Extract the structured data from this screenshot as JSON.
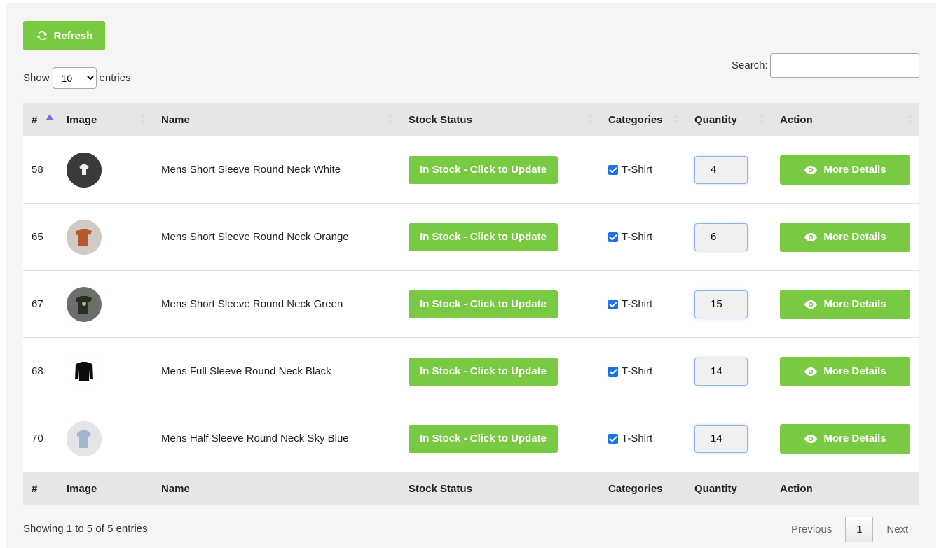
{
  "toolbar": {
    "refresh_label": "Refresh"
  },
  "length": {
    "show_label": "Show",
    "selected": "10",
    "entries_label": "entries"
  },
  "search": {
    "label": "Search:",
    "value": ""
  },
  "columns": [
    "#",
    "Image",
    "Name",
    "Stock Status",
    "Categories",
    "Quantity",
    "Action"
  ],
  "rows": [
    {
      "id": "58",
      "name": "Mens Short Sleeve Round Neck White",
      "stock": "In Stock - Click to Update",
      "category": "T-Shirt",
      "quantity": "4",
      "action": "More Details",
      "thumb_color": "#3a3a3a"
    },
    {
      "id": "65",
      "name": "Mens Short Sleeve Round Neck Orange",
      "stock": "In Stock - Click to Update",
      "category": "T-Shirt",
      "quantity": "6",
      "action": "More Details",
      "thumb_color": "#b8562e"
    },
    {
      "id": "67",
      "name": "Mens Short Sleeve Round Neck Green",
      "stock": "In Stock - Click to Update",
      "category": "T-Shirt",
      "quantity": "15",
      "action": "More Details",
      "thumb_color": "#2f3b2c"
    },
    {
      "id": "68",
      "name": "Mens Full Sleeve Round Neck Black",
      "stock": "In Stock - Click to Update",
      "category": "T-Shirt",
      "quantity": "14",
      "action": "More Details",
      "thumb_color": "#ffffff"
    },
    {
      "id": "70",
      "name": "Mens Half Sleeve Round Neck Sky Blue",
      "stock": "In Stock - Click to Update",
      "category": "T-Shirt",
      "quantity": "14",
      "action": "More Details",
      "thumb_color": "#d9dde2"
    }
  ],
  "footer": {
    "info": "Showing 1 to 5 of 5 entries",
    "previous": "Previous",
    "current_page": "1",
    "next": "Next"
  },
  "colors": {
    "accent_green": "#7ac943",
    "sort_active": "#6b74d8",
    "checkbox": "#1a73e8"
  }
}
